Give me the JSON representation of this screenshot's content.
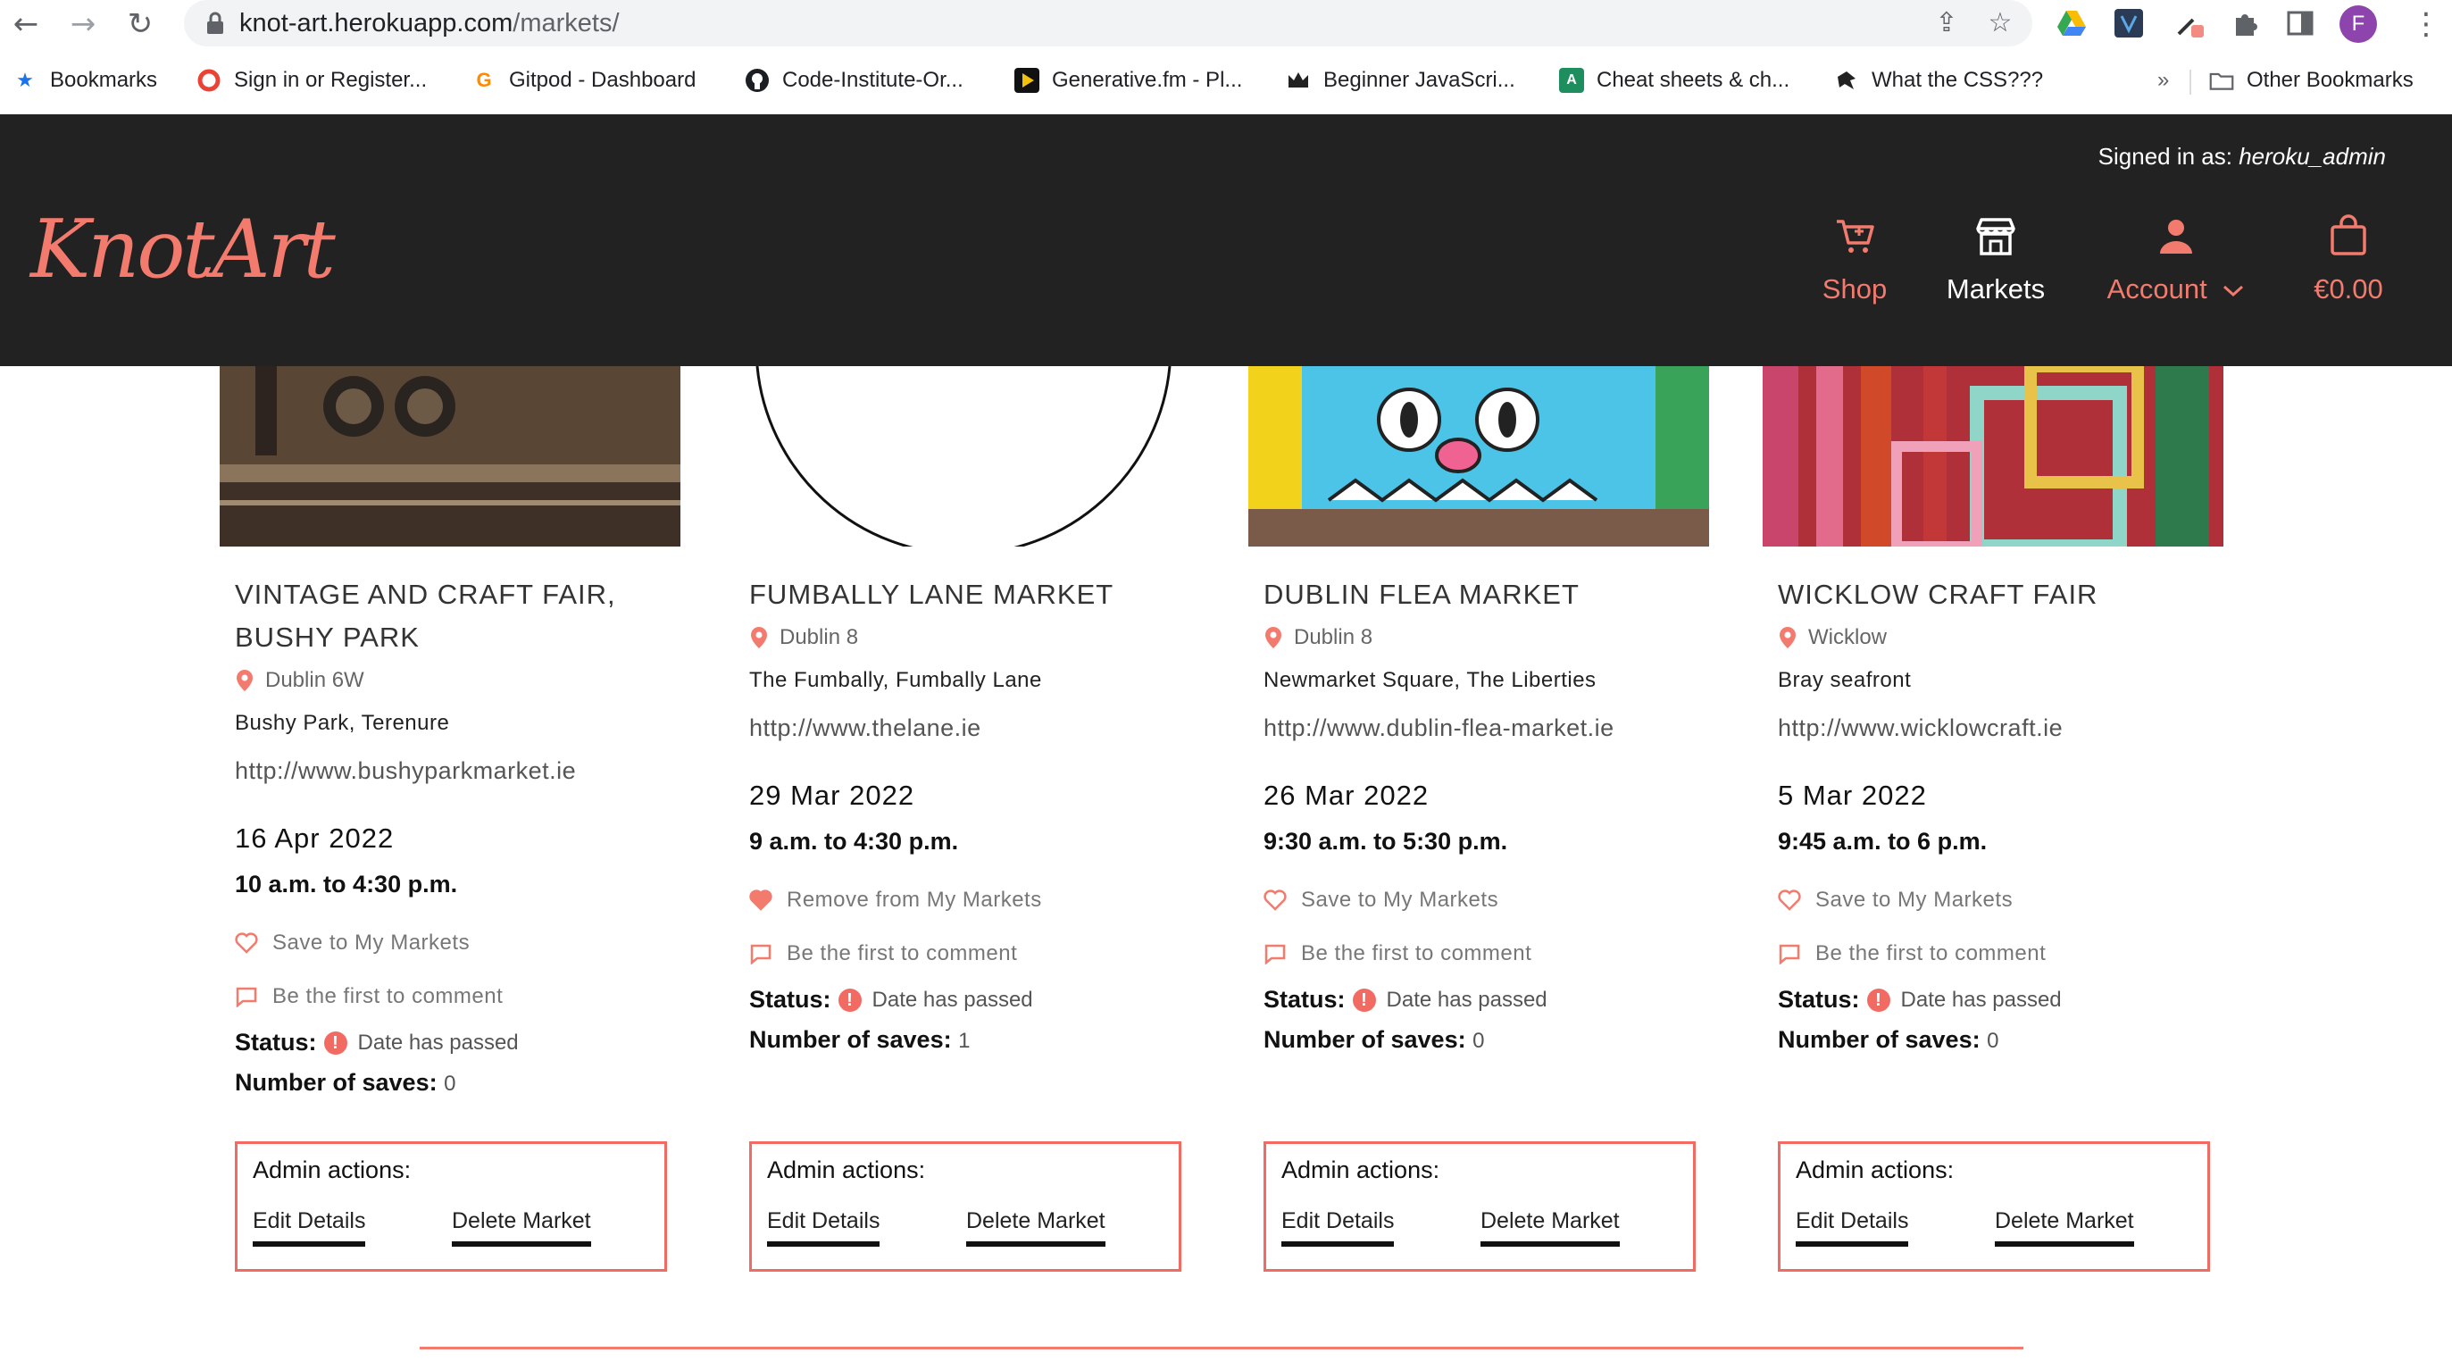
{
  "browser": {
    "url_host": "knot-art.herokuapp.com",
    "url_path": "/markets/",
    "profile_initial": "F",
    "bookmarks": [
      {
        "label": "Bookmarks",
        "icon": "star-icon"
      },
      {
        "label": "Sign in or Register...",
        "icon": "opera-icon"
      },
      {
        "label": "Gitpod - Dashboard",
        "icon": "gitpod-icon"
      },
      {
        "label": "Code-Institute-Or...",
        "icon": "github-icon"
      },
      {
        "label": "Generative.fm - Pl...",
        "icon": "generativefm-icon"
      },
      {
        "label": "Beginner JavaScri...",
        "icon": "crown-icon"
      },
      {
        "label": "Cheat sheets & ch...",
        "icon": "cheatsheet-icon"
      },
      {
        "label": "What the CSS???",
        "icon": "whatthecss-icon"
      }
    ],
    "overflow_label": "»",
    "other_bookmarks": "Other Bookmarks"
  },
  "header": {
    "logo": "KnotArt",
    "signed_in_prefix": "Signed in as:",
    "signed_in_user": "heroku_admin",
    "nav": {
      "shop": "Shop",
      "markets": "Markets",
      "account": "Account",
      "bag_total": "€0.00"
    }
  },
  "colors": {
    "accent": "#f37b6e",
    "header_bg": "#222222",
    "status": "#f26b63"
  },
  "markets": [
    {
      "title": "VINTAGE AND CRAFT FAIR, BUSHY PARK",
      "location": "Dublin 6W",
      "address": "Bushy Park, Terenure",
      "url": "http://www.bushyparkmarket.ie",
      "date": "16 Apr 2022",
      "time": "10 a.m. to 4:30 p.m.",
      "save_label": "Save to My Markets",
      "saved": false,
      "comment_label": "Be the first to comment",
      "status_label": "Status:",
      "status_text": "Date has passed",
      "saves_label": "Number of saves:",
      "saves": "0",
      "admin_title": "Admin actions:",
      "edit_label": "Edit Details",
      "delete_label": "Delete Market"
    },
    {
      "title": "FUMBALLY LANE MARKET",
      "location": "Dublin 8",
      "address": "The Fumbally, Fumbally Lane",
      "url": "http://www.thelane.ie",
      "date": "29 Mar 2022",
      "time": "9 a.m. to 4:30 p.m.",
      "save_label": "Remove from My Markets",
      "saved": true,
      "comment_label": "Be the first to comment",
      "status_label": "Status:",
      "status_text": "Date has passed",
      "saves_label": "Number of saves:",
      "saves": "1",
      "admin_title": "Admin actions:",
      "edit_label": "Edit Details",
      "delete_label": "Delete Market"
    },
    {
      "title": "DUBLIN FLEA MARKET",
      "location": "Dublin 8",
      "address": "Newmarket Square, The Liberties",
      "url": "http://www.dublin-flea-market.ie",
      "date": "26 Mar 2022",
      "time": "9:30 a.m. to 5:30 p.m.",
      "save_label": "Save to My Markets",
      "saved": false,
      "comment_label": "Be the first to comment",
      "status_label": "Status:",
      "status_text": "Date has passed",
      "saves_label": "Number of saves:",
      "saves": "0",
      "admin_title": "Admin actions:",
      "edit_label": "Edit Details",
      "delete_label": "Delete Market"
    },
    {
      "title": "WICKLOW CRAFT FAIR",
      "location": "Wicklow",
      "address": "Bray seafront",
      "url": "http://www.wicklowcraft.ie",
      "date": "5 Mar 2022",
      "time": "9:45 a.m. to 6 p.m.",
      "save_label": "Save to My Markets",
      "saved": false,
      "comment_label": "Be the first to comment",
      "status_label": "Status:",
      "status_text": "Date has passed",
      "saves_label": "Number of saves:",
      "saves": "0",
      "admin_title": "Admin actions:",
      "edit_label": "Edit Details",
      "delete_label": "Delete Market"
    }
  ]
}
